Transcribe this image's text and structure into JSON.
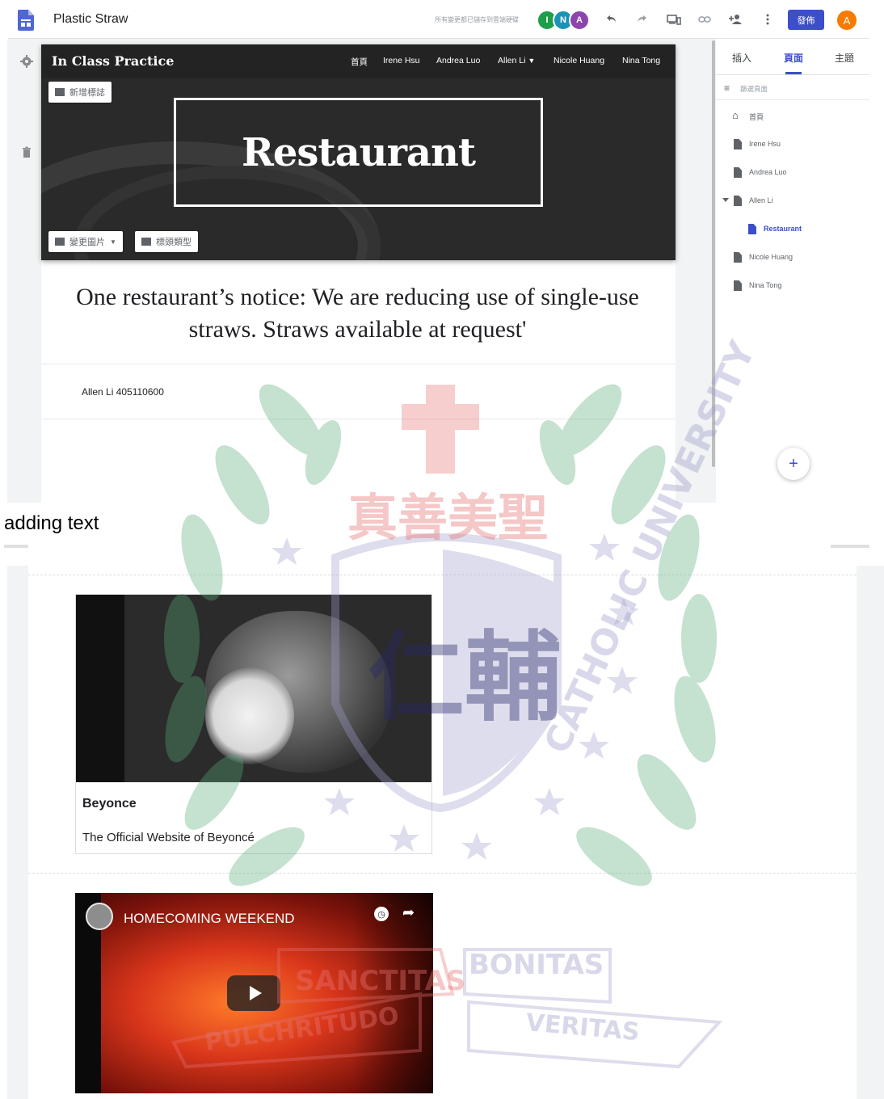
{
  "app": {
    "site_title": "Plastic Straw",
    "saved_message": "所有變更都已儲存到雲端硬碟",
    "collaborators": [
      "I",
      "N",
      "A"
    ],
    "publish_label": "發佈",
    "user_initial": "A",
    "icons": [
      "undo-icon",
      "redo-icon",
      "preview-devices-icon",
      "link-icon",
      "share-add-person-icon",
      "more-vert-icon"
    ]
  },
  "header": {
    "brand": "In Class Practice",
    "nav": [
      "首頁",
      "Irene Hsu",
      "Andrea Luo",
      "Allen Li",
      "Nicole Huang",
      "Nina Tong"
    ],
    "add_logo": "新增標誌",
    "change_image": "變更圖片",
    "header_type": "標頭類型",
    "title": "Restaurant"
  },
  "content": {
    "quote": "One restaurant’s notice: We are reducing use of single-use straws. Straws available at request'",
    "author": "Allen Li 405110600"
  },
  "panel": {
    "tabs": [
      "插入",
      "頁面",
      "主題"
    ],
    "active_tab": "頁面",
    "filter_placeholder": "篩選頁面",
    "pages": [
      {
        "label": "首頁",
        "icon": "home-icon"
      },
      {
        "label": "Irene Hsu",
        "icon": "page-icon"
      },
      {
        "label": "Andrea Luo",
        "icon": "page-icon"
      },
      {
        "label": "Allen Li",
        "icon": "page-icon",
        "expanded": true
      },
      {
        "label": "Restaurant",
        "icon": "page-icon",
        "active": true
      },
      {
        "label": "Nicole Huang",
        "icon": "page-icon"
      },
      {
        "label": "Nina Tong",
        "icon": "page-icon"
      }
    ]
  },
  "caption": "adding text",
  "embed_card": {
    "title": "Beyonce",
    "description": "The Official Website of Beyoncé"
  },
  "video": {
    "title": "HOMECOMING WEEKEND"
  },
  "colors": {
    "accent": "#3c4fc8",
    "header_dark": "#2a2a2a",
    "avatar_orange": "#f57c00",
    "watermark_green": "#7fbf8f",
    "watermark_red": "#e57373",
    "watermark_purple": "#9e9ecb"
  },
  "watermark": {
    "chinese_motto": "真善美聖",
    "university": "CATHOLIC UNIVERSITY",
    "emblem_char": "仁輔",
    "banner_words": [
      "SANCTITAS",
      "BONITAS",
      "PULCHRITUDO",
      "VERITAS"
    ]
  }
}
